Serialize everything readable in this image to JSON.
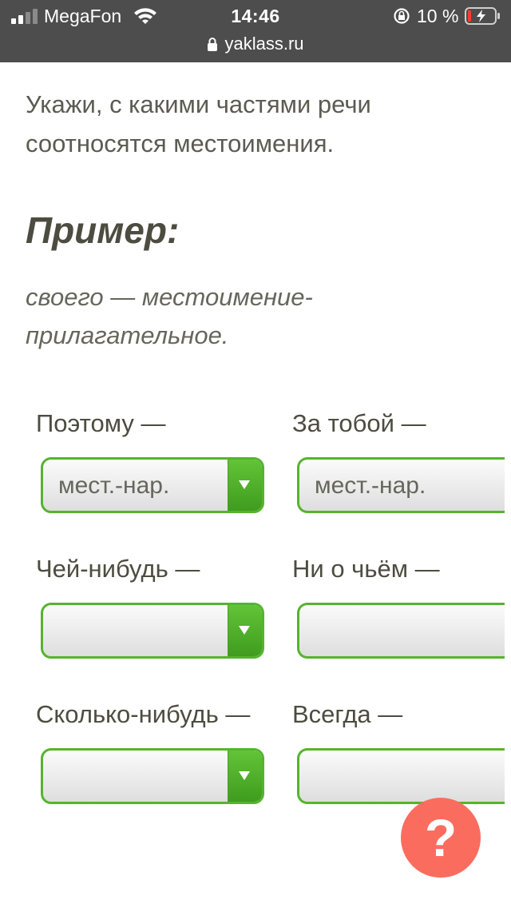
{
  "status_bar": {
    "carrier": "MegaFon",
    "time": "14:46",
    "battery_percent": "10 %",
    "url": "yaklass.ru",
    "icons": [
      "signal-icon",
      "wifi-icon",
      "rotation-lock-icon",
      "battery-icon",
      "padlock-icon"
    ]
  },
  "task": {
    "instruction": "Укажи, с какими частями речи соотносятся местоимения.",
    "example_heading": "Пример:",
    "example_text": "своего — местоимение-прилагательное."
  },
  "items": [
    {
      "label": "Поэтому —",
      "selected": "мест.-нар."
    },
    {
      "label": "За тобой —",
      "selected": "мест.-нар."
    },
    {
      "label": "Чей-нибудь —",
      "selected": ""
    },
    {
      "label": "Ни о чьём —",
      "selected": ""
    },
    {
      "label": "Сколько-нибудь —",
      "selected": ""
    },
    {
      "label": "Всегда —",
      "selected": ""
    }
  ],
  "help_button": {
    "symbol": "?",
    "color": "#fa6d5e"
  },
  "colors": {
    "accent_green": "#55b42d",
    "status_bar_bg": "#4d4d4d",
    "text": "#5a5a50"
  }
}
